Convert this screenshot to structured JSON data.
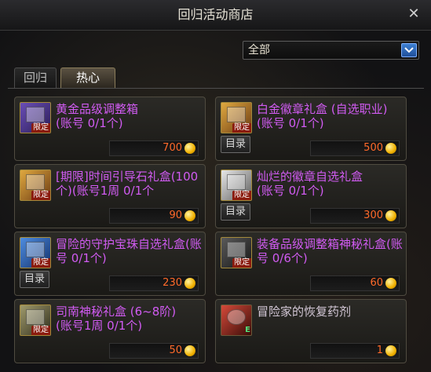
{
  "window": {
    "title": "回归活动商店",
    "close_glyph": "✕"
  },
  "filter": {
    "selected": "全部"
  },
  "tabs": [
    {
      "label": "回归",
      "active": false
    },
    {
      "label": "热心",
      "active": true
    }
  ],
  "items": [
    {
      "name": "黄金品级调整箱\n(账号 0/1个)",
      "price": "700",
      "tag": "限定",
      "catalog": "",
      "icon": "purple-box-icon"
    },
    {
      "name": "白金徽章礼盒 (自选职业)(账号 0/1个)",
      "price": "500",
      "tag": "限定",
      "catalog": "目录",
      "icon": "gold-box-icon"
    },
    {
      "name": "[期限]时间引导石礼盒(100个)(账号1周 0/1个",
      "price": "90",
      "tag": "限定",
      "catalog": "",
      "icon": "gold-chest-icon"
    },
    {
      "name": "灿烂的徽章自选礼盒\n(账号 0/1个)",
      "price": "300",
      "tag": "限定",
      "catalog": "目录",
      "icon": "white-box-icon"
    },
    {
      "name": "冒险的守护宝珠自选礼盒(账号 0/1个)",
      "price": "230",
      "tag": "限定",
      "catalog": "目录",
      "icon": "blue-box-icon"
    },
    {
      "name": "装备品级调整箱神秘礼盒(账号 0/6个)",
      "price": "60",
      "tag": "限定",
      "catalog": "",
      "icon": "dark-box-icon"
    },
    {
      "name": "司南神秘礼盒 (6~8阶)\n(账号1周 0/1个)",
      "price": "50",
      "tag": "限定",
      "catalog": "",
      "icon": "compass-box-icon"
    },
    {
      "name": "冒险家的恢复药剂",
      "price": "1",
      "tag": "",
      "catalog": "",
      "icon": "potion-icon",
      "etag": "E"
    }
  ]
}
